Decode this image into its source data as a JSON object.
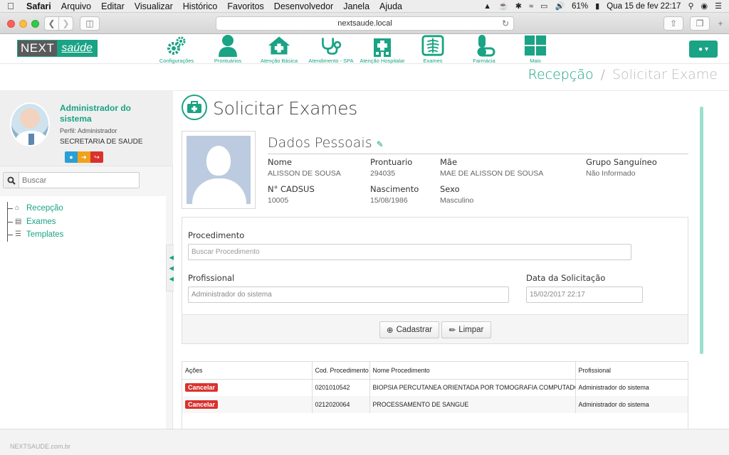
{
  "menubar": {
    "app": "Safari",
    "items": [
      "Arquivo",
      "Editar",
      "Visualizar",
      "Histórico",
      "Favoritos",
      "Desenvolvedor",
      "Janela",
      "Ajuda"
    ],
    "battery": "61%",
    "datetime": "Qua 15 de fev  22:17"
  },
  "browser": {
    "url": "nextsaude.local"
  },
  "logo": {
    "part1": "NEXT",
    "part2": "saúde"
  },
  "nav": [
    {
      "label": "Configurações",
      "icon": "gears-icon"
    },
    {
      "label": "Prontuários",
      "icon": "person-icon"
    },
    {
      "label": "Atenção Básica",
      "icon": "house-icon"
    },
    {
      "label": "Atendimento - SPA",
      "icon": "stethoscope-icon"
    },
    {
      "label": "Atenção Hospitalar",
      "icon": "hospital-icon"
    },
    {
      "label": "Exames",
      "icon": "xray-icon"
    },
    {
      "label": "Farmácia",
      "icon": "pill-icon"
    },
    {
      "label": "Mais",
      "icon": "grid-icon"
    }
  ],
  "breadcrumb": {
    "first": "Recepção",
    "separator": "/",
    "current": "Solicitar Exame"
  },
  "sidebar": {
    "user_name": "Administrador do sistema",
    "perfil": "Perfil: Administrador",
    "secretaria": "SECRETARIA DE SAUDE",
    "search_placeholder": "Buscar",
    "tree": [
      {
        "label": "Recepção",
        "icon": "home-icon"
      },
      {
        "label": "Exames",
        "icon": "file-icon"
      },
      {
        "label": "Templates",
        "icon": "list-icon"
      }
    ]
  },
  "page": {
    "title": "Solicitar Exames"
  },
  "dados": {
    "title": "Dados Pessoais",
    "fields": [
      {
        "label": "Nome",
        "value": "ALISSON DE SOUSA"
      },
      {
        "label": "Prontuario",
        "value": "294035"
      },
      {
        "label": "Mãe",
        "value": "MAE DE ALISSON DE SOUSA"
      },
      {
        "label": "Grupo Sanguíneo",
        "value": "Não Informado"
      },
      {
        "label": "N° CADSUS",
        "value": "10005"
      },
      {
        "label": "Nascimento",
        "value": "15/08/1986"
      },
      {
        "label": "Sexo",
        "value": "Masculino"
      }
    ]
  },
  "form": {
    "procedimento_label": "Procedimento",
    "procedimento_placeholder": "Buscar Procedimento",
    "profissional_label": "Profissional",
    "profissional_value": "Administrador do sistema",
    "data_label": "Data da Solicitação",
    "data_value": "15/02/2017 22:17",
    "cadastrar": "Cadastrar",
    "limpar": "Limpar"
  },
  "table": {
    "headers": [
      "Ações",
      "Cod. Procedimento",
      "Nome Procedimento",
      "Profissional"
    ],
    "cancel_label": "Cancelar",
    "rows": [
      {
        "codigo": "0201010542",
        "nome": "BIOPSIA PERCUTANEA ORIENTADA POR TOMOGRAFIA COMPUTADORIZADA",
        "profissional": "Administrador do sistema"
      },
      {
        "codigo": "0212020064",
        "nome": "PROCESSAMENTO DE SANGUE",
        "profissional": "Administrador do sistema"
      }
    ]
  },
  "footer": {
    "text": "NEXTSAUDE.com.br"
  },
  "colors": {
    "brand": "#1aa384",
    "danger": "#d9322e",
    "info": "#2a9fd6",
    "warning": "#f0a21b"
  }
}
